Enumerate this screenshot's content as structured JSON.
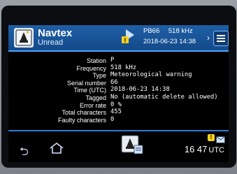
{
  "header": {
    "app_title": "Navtex",
    "app_subtitle": "Unread",
    "station_id": "PB66",
    "frequency": "518 kHz",
    "timestamp": "2018-06-23 14:38"
  },
  "details": [
    {
      "label": "Station",
      "value": "P"
    },
    {
      "label": "Frequency",
      "value": "518 kHz"
    },
    {
      "label": "Type",
      "value": "Meteorological warning"
    },
    {
      "label": "Serial number",
      "value": "66"
    },
    {
      "label": "Time (UTC)",
      "value": "2018-06-23 14:38"
    },
    {
      "label": "Tagged",
      "value": "No (automatic delete allowed)"
    },
    {
      "label": "Error rate",
      "value": "0 %"
    },
    {
      "label": "Total characters",
      "value": "455"
    },
    {
      "label": "Faulty characters",
      "value": "0"
    }
  ],
  "footer": {
    "clock_time": "16 47",
    "clock_tz": "UTC"
  },
  "colors": {
    "header_blue": "#1f5fa6",
    "accent_blue": "#2e7bd6",
    "warning_yellow": "#f5d21a",
    "screen_bg": "#000000"
  },
  "icons": [
    "navtex-app-icon",
    "message-warning-icon",
    "chevron-right-icon",
    "menu-icon",
    "back-icon",
    "home-icon",
    "ship-message-icon",
    "status-warning-icon",
    "status-message-icon"
  ]
}
